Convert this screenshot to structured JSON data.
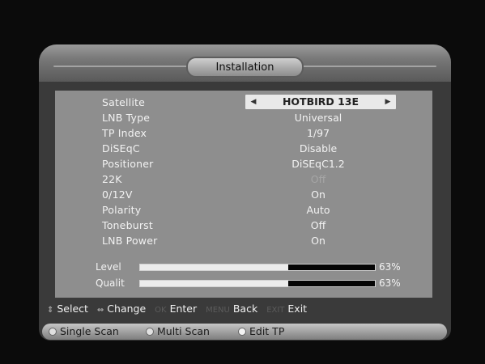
{
  "title": "Installation",
  "settings": [
    {
      "label": "Satellite",
      "value": "HOTBIRD 13E"
    },
    {
      "label": "LNB Type",
      "value": "Universal"
    },
    {
      "label": "TP Index",
      "value": "1/97"
    },
    {
      "label": "DiSEqC",
      "value": "Disable"
    },
    {
      "label": "Positioner",
      "value": "DiSEqC1.2"
    },
    {
      "label": "22K",
      "value": "Off"
    },
    {
      "label": "0/12V",
      "value": "On"
    },
    {
      "label": "Polarity",
      "value": "Auto"
    },
    {
      "label": "Toneburst",
      "value": "Off"
    },
    {
      "label": "LNB Power",
      "value": "On"
    }
  ],
  "signal": {
    "level_label": "Level",
    "level_pct": "63%",
    "level_value": 63,
    "quality_label": "Qualit",
    "quality_pct": "63%",
    "quality_value": 63
  },
  "help": {
    "select_key": "⇕",
    "select": "Select",
    "change_key": "⇔",
    "change": "Change",
    "ok_key": "OK",
    "ok": "Enter",
    "menu_key": "MENU",
    "menu": "Back",
    "exit_key": "EXIT",
    "exit": "Exit"
  },
  "scan_buttons": {
    "single": "Single Scan",
    "multi": "Multi Scan",
    "edit": "Edit TP"
  },
  "colors": {
    "panel": "#8e8e8e",
    "frame": "#3a3a3a",
    "highlight": "#e9e9e9"
  }
}
